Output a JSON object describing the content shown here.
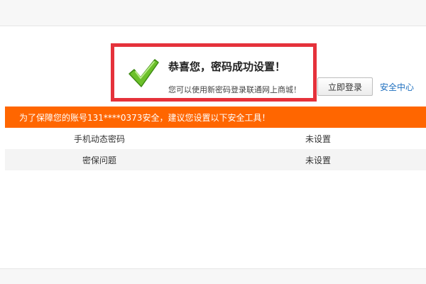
{
  "success": {
    "icon": "checkmark-icon",
    "title": "恭喜您，密码成功设置！",
    "description": "您可以使用新密码登录联通网上商城！"
  },
  "actions": {
    "login_label": "立即登录",
    "security_center_label": "安全中心"
  },
  "banner": {
    "text": "为了保障您的账号131****0373安全，建议您设置以下安全工具！"
  },
  "tools": [
    {
      "name": "手机动态密码",
      "status": "未设置"
    },
    {
      "name": "密保问题",
      "status": "未设置"
    }
  ],
  "colors": {
    "banner": "#ff6600",
    "highlight_border": "#e5323b",
    "checkmark": "#6cc02a",
    "link": "#1e6fbf"
  }
}
